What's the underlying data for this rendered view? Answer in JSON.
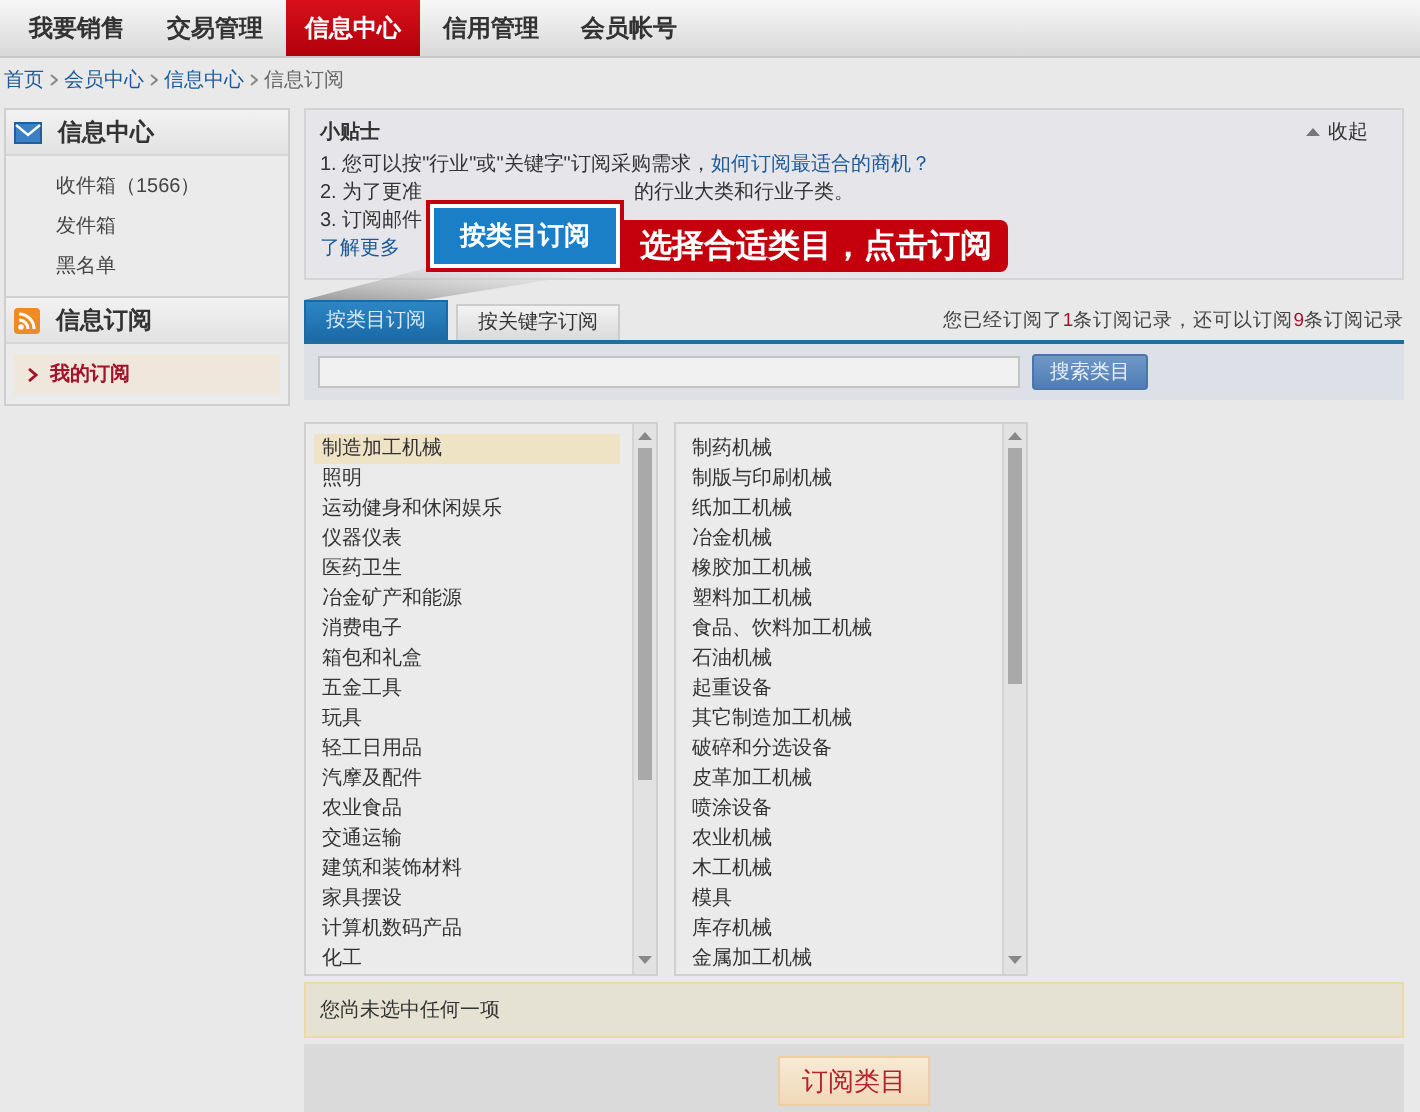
{
  "nav": [
    {
      "label": "我要销售",
      "selected": false
    },
    {
      "label": "交易管理",
      "selected": false
    },
    {
      "label": "信息中心",
      "selected": true
    },
    {
      "label": "信用管理",
      "selected": false
    },
    {
      "label": "会员帐号",
      "selected": false
    }
  ],
  "breadcrumb": [
    {
      "label": "首页",
      "kind": "link"
    },
    {
      "label": "会员中心",
      "kind": "link"
    },
    {
      "label": "信息中心",
      "kind": "link"
    },
    {
      "label": "信息订阅",
      "kind": "current"
    }
  ],
  "sidebar": [
    {
      "title": "信息中心",
      "kind": "mail",
      "items": [
        {
          "label": "收件箱（1566）",
          "selected": false
        },
        {
          "label": "发件箱",
          "selected": false
        },
        {
          "label": "黑名单",
          "selected": false
        }
      ]
    },
    {
      "title": "信息订阅",
      "kind": "rss",
      "items": [
        {
          "label": "我的订阅",
          "selected": true
        }
      ]
    }
  ],
  "tips": {
    "title": "小贴士",
    "collapse": "收起",
    "lines": [
      {
        "segments": [
          {
            "text": "1. 您可以按\"行业\"或\"关键字\"订阅采购需求，",
            "kind": "text"
          },
          {
            "text": "如何订阅最适合的商机？",
            "kind": "link"
          }
        ]
      },
      {
        "segments": [
          {
            "text": "2. 为了更准",
            "kind": "text"
          },
          {
            "text": "的行业大类和行业子类。",
            "kind": "resumed"
          }
        ]
      },
      {
        "segments": [
          {
            "text": "3. 订阅邮件",
            "kind": "text"
          }
        ]
      },
      {
        "segments": [
          {
            "text": "了解更多",
            "kind": "link"
          }
        ]
      }
    ]
  },
  "callout": {
    "button": "按类目订阅",
    "label": "选择合适类目，点击订阅"
  },
  "tabs": [
    {
      "label": "按类目订阅",
      "selected": true
    },
    {
      "label": "按关键字订阅",
      "selected": false
    }
  ],
  "quota": [
    {
      "text": "您已经订阅了",
      "kind": "text"
    },
    {
      "text": "1",
      "kind": "count"
    },
    {
      "text": "条订阅记录，还可以订阅",
      "kind": "text"
    },
    {
      "text": "9",
      "kind": "count"
    },
    {
      "text": "条订阅记录",
      "kind": "text"
    }
  ],
  "search": {
    "button": "搜索类目"
  },
  "lists": [
    {
      "items": [
        {
          "label": "制造加工机械",
          "selected": true
        },
        {
          "label": "照明",
          "selected": false
        },
        {
          "label": "运动健身和休闲娱乐",
          "selected": false
        },
        {
          "label": "仪器仪表",
          "selected": false
        },
        {
          "label": "医药卫生",
          "selected": false
        },
        {
          "label": "冶金矿产和能源",
          "selected": false
        },
        {
          "label": "消费电子",
          "selected": false
        },
        {
          "label": "箱包和礼盒",
          "selected": false
        },
        {
          "label": "五金工具",
          "selected": false
        },
        {
          "label": "玩具",
          "selected": false
        },
        {
          "label": "轻工日用品",
          "selected": false
        },
        {
          "label": "汽摩及配件",
          "selected": false
        },
        {
          "label": "农业食品",
          "selected": false
        },
        {
          "label": "交通运输",
          "selected": false
        },
        {
          "label": "建筑和装饰材料",
          "selected": false
        },
        {
          "label": "家具摆设",
          "selected": false
        },
        {
          "label": "计算机数码产品",
          "selected": false
        },
        {
          "label": "化工",
          "selected": false
        }
      ]
    },
    {
      "items": [
        {
          "label": "制药机械",
          "selected": false
        },
        {
          "label": "制版与印刷机械",
          "selected": false
        },
        {
          "label": "纸加工机械",
          "selected": false
        },
        {
          "label": "冶金机械",
          "selected": false
        },
        {
          "label": "橡胶加工机械",
          "selected": false
        },
        {
          "label": "塑料加工机械",
          "selected": false
        },
        {
          "label": "食品、饮料加工机械",
          "selected": false
        },
        {
          "label": "石油机械",
          "selected": false
        },
        {
          "label": "起重设备",
          "selected": false
        },
        {
          "label": "其它制造加工机械",
          "selected": false
        },
        {
          "label": "破碎和分选设备",
          "selected": false
        },
        {
          "label": "皮革加工机械",
          "selected": false
        },
        {
          "label": "喷涂设备",
          "selected": false
        },
        {
          "label": "农业机械",
          "selected": false
        },
        {
          "label": "木工机械",
          "selected": false
        },
        {
          "label": "模具",
          "selected": false
        },
        {
          "label": "库存机械",
          "selected": false
        },
        {
          "label": "金属加工机械",
          "selected": false
        }
      ]
    }
  ],
  "status": "您尚未选中任何一项",
  "submit": "订阅类目"
}
